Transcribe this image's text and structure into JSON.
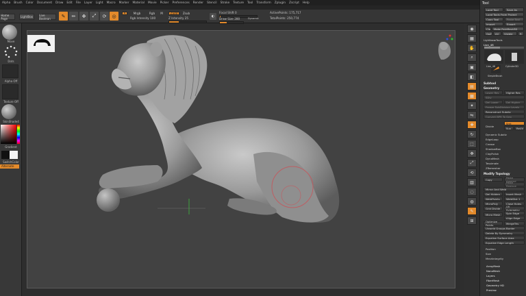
{
  "menu": {
    "items": [
      "Alpha",
      "Brush",
      "Color",
      "Document",
      "Draw",
      "Edit",
      "File",
      "Layer",
      "Light",
      "Macro",
      "Marker",
      "Material",
      "Movie",
      "Picker",
      "Preferences",
      "Render",
      "Stencil",
      "Stroke",
      "Texture",
      "Tool",
      "Transform",
      "Zplugin",
      "Zscript",
      "Help"
    ],
    "right": [
      "Menus",
      "DefaultZScript"
    ]
  },
  "info": {
    "text": "1.4% 108.2.98"
  },
  "shelf": {
    "home_tab": "Home Page",
    "lightbox_tab": "LightBox",
    "live_boolean": "Live Boolean",
    "edit_label": "Edit",
    "draw_label": "Draw",
    "move_label": "Move",
    "scale_label": "Scale",
    "rotate_label": "Rotate",
    "mrgb_label": "Mrgb",
    "rgb_label": "Rgb",
    "m_label": "M",
    "zadd_label": "Zadd",
    "zsub_label": "Zsub",
    "rgb_intensity_label": "Rgb Intensity 100",
    "z_intensity_label": "Z Intensity 25",
    "z_intensity_value": 0.25,
    "focal_shift_label": "Focal Shift 0",
    "draw_size_label": "Draw Size 280",
    "draw_size_value": 0.28,
    "dynamic_label": "Dynamic",
    "active_points": "ActivePoints: 175,717",
    "total_points": "TotalPoints: 250,774"
  },
  "left": {
    "brush_label": "Move",
    "stroke_label": "Dots",
    "alpha_label": "Alpha Off",
    "texture_label": "Texture Off",
    "material_label": "SkinShade4",
    "gradient_label": "Gradient",
    "switch_label": "SwitchColor",
    "alternate_label": "Alternate"
  },
  "tray": {
    "title": "Tool",
    "buttons": [
      "Load Tool",
      "Save As",
      "Load Tools From Project",
      "Copy Tool",
      "Paste Tool",
      "Import",
      "Export",
      "Clone",
      "Make PolyMesh3D",
      "GoZ",
      "All",
      "Visible",
      "R"
    ],
    "lightbox_tools": "Lightbox▸Tools",
    "tool_name": "Lion_48",
    "tool_thumb_labels": [
      "Lion_48",
      "Cylinder3D",
      "SimpleBrush"
    ],
    "subtool_label": "Subtool",
    "geometry_label": "Geometry",
    "geo_buttons": [
      "Lower Res",
      "Higher Res",
      "SDiv",
      "Del Lower",
      "Del Higher",
      "Freeze SubDivision Levels",
      "Reconstruct Subdiv",
      "Convert BPR To Geo"
    ],
    "divide_label": "Divide",
    "smt_label": "Smt",
    "suv_label": "Suv",
    "rsmt_label": "ReUV",
    "dynamic_subdiv": "Dynamic Subdiv",
    "edgeloop": "EdgeLoop",
    "crease": "Crease",
    "shadowbox": "ShadowBox",
    "claypolish": "ClayPolish",
    "dynamesh": "DynaMesh",
    "tessimate": "Tessimate",
    "zremesher": "ZRemesher",
    "modify_topology": "Modify Topology",
    "topo_buttons": [
      "Copy",
      "Paste Append",
      "Paste Replace",
      "Mirror And Weld",
      "Del Hidden",
      "Insert Mesh",
      "WeldPoints",
      "WeldDist 1",
      "MicroPoly",
      "Close Holes",
      "Grid Divide",
      "UV Symmetry",
      "Micro Mesh",
      "Spin Edge",
      "Align Edge",
      "Optimize Points",
      "MergeTris",
      "Unweld Groups Border",
      "Delete By Symmetry",
      "Equalize Surface Area",
      "Equalize Edge Length"
    ],
    "sections": [
      "Position",
      "Size",
      "MeshIntegrity",
      "ArrayMesh",
      "NanoMesh",
      "Layers",
      "FiberMesh",
      "Geometry HD",
      "Preview"
    ]
  }
}
